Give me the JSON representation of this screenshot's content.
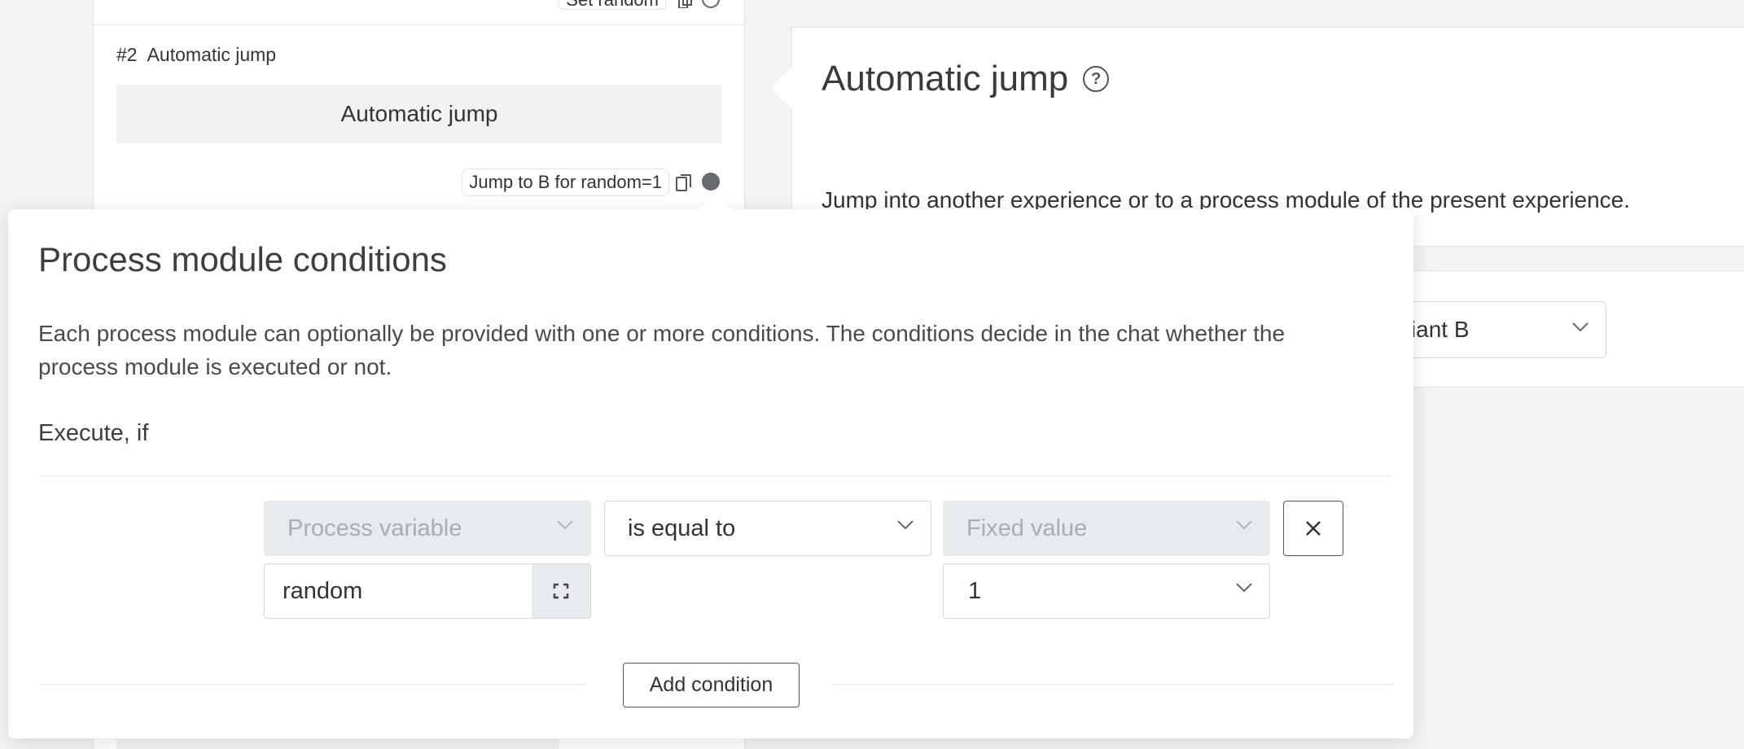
{
  "previous_module": {
    "condition_badge": "Set random"
  },
  "module": {
    "number": "#2",
    "name": "Automatic jump",
    "title": "Automatic jump",
    "condition_badge": "Jump to B for random=1"
  },
  "detail": {
    "title": "Automatic jump",
    "description": "Jump into another experience or to a process module of the present experience.",
    "target_select": "variant B"
  },
  "dialog": {
    "title": "Process module conditions",
    "description": "Each process module can optionally be provided with one or more conditions. The conditions decide in the chat whether the process module is executed or not.",
    "execute_label": "Execute, if",
    "condition": {
      "left_type": "Process variable",
      "operator": "is equal to",
      "right_type": "Fixed value",
      "variable_value": "random",
      "fixed_value": "1"
    },
    "add_condition_label": "Add condition"
  },
  "colors": {
    "background": "#f3f3f3",
    "panel": "#ffffff",
    "disabled_field": "#e8ebee",
    "disabled_text": "#a8adb3",
    "status_dot": "#66696d"
  },
  "icons": [
    "copy-icon",
    "status-dot",
    "help-icon",
    "chevron-down-icon",
    "close-icon",
    "expand-icon"
  ]
}
